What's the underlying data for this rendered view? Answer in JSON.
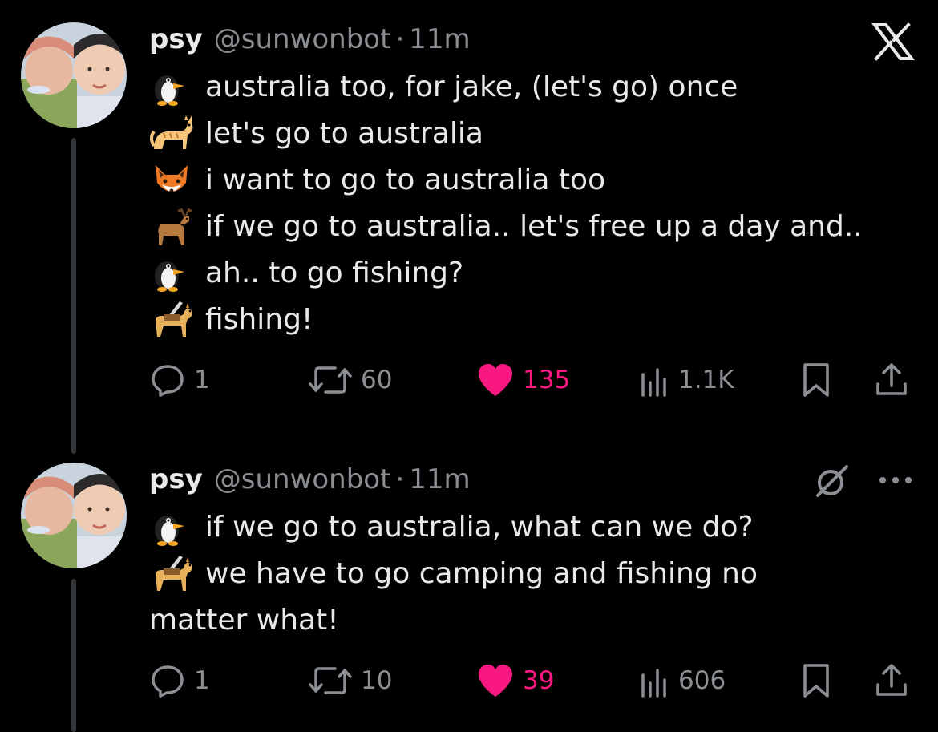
{
  "brand": {
    "icon": "x-logo-icon",
    "color": "#e7e9ea"
  },
  "colors": {
    "background": "#000000",
    "text": "#e7e9ea",
    "muted": "#8b8f94",
    "like": "#f91880"
  },
  "tweets": [
    {
      "author": {
        "name": "psy",
        "handle": "@sunwonbot",
        "time": "11m",
        "separator": "·"
      },
      "lines": [
        {
          "emoji": "penguin",
          "text": "australia too, for jake, (let's go) once"
        },
        {
          "emoji": "cat",
          "text": "let's go to australia"
        },
        {
          "emoji": "fox",
          "text": "i want to go to australia too"
        },
        {
          "emoji": "deer",
          "text": "if we go to australia.. let's free up a day and.."
        },
        {
          "emoji": "penguin",
          "text": "ah.. to go fishing?"
        },
        {
          "emoji": "guide-dog",
          "text": "fishing!"
        }
      ],
      "stats": {
        "replies": "1",
        "reposts": "60",
        "likes": "135",
        "views": "1.1K"
      }
    },
    {
      "author": {
        "name": "psy",
        "handle": "@sunwonbot",
        "time": "11m",
        "separator": "·"
      },
      "lines": [
        {
          "emoji": "penguin",
          "text": "if we go to australia, what can we do?"
        },
        {
          "emoji": "guide-dog",
          "text": "we have to go camping and fishing no"
        }
      ],
      "continuation": "matter what!",
      "stats": {
        "replies": "1",
        "reposts": "10",
        "likes": "39",
        "views": "606"
      }
    }
  ]
}
